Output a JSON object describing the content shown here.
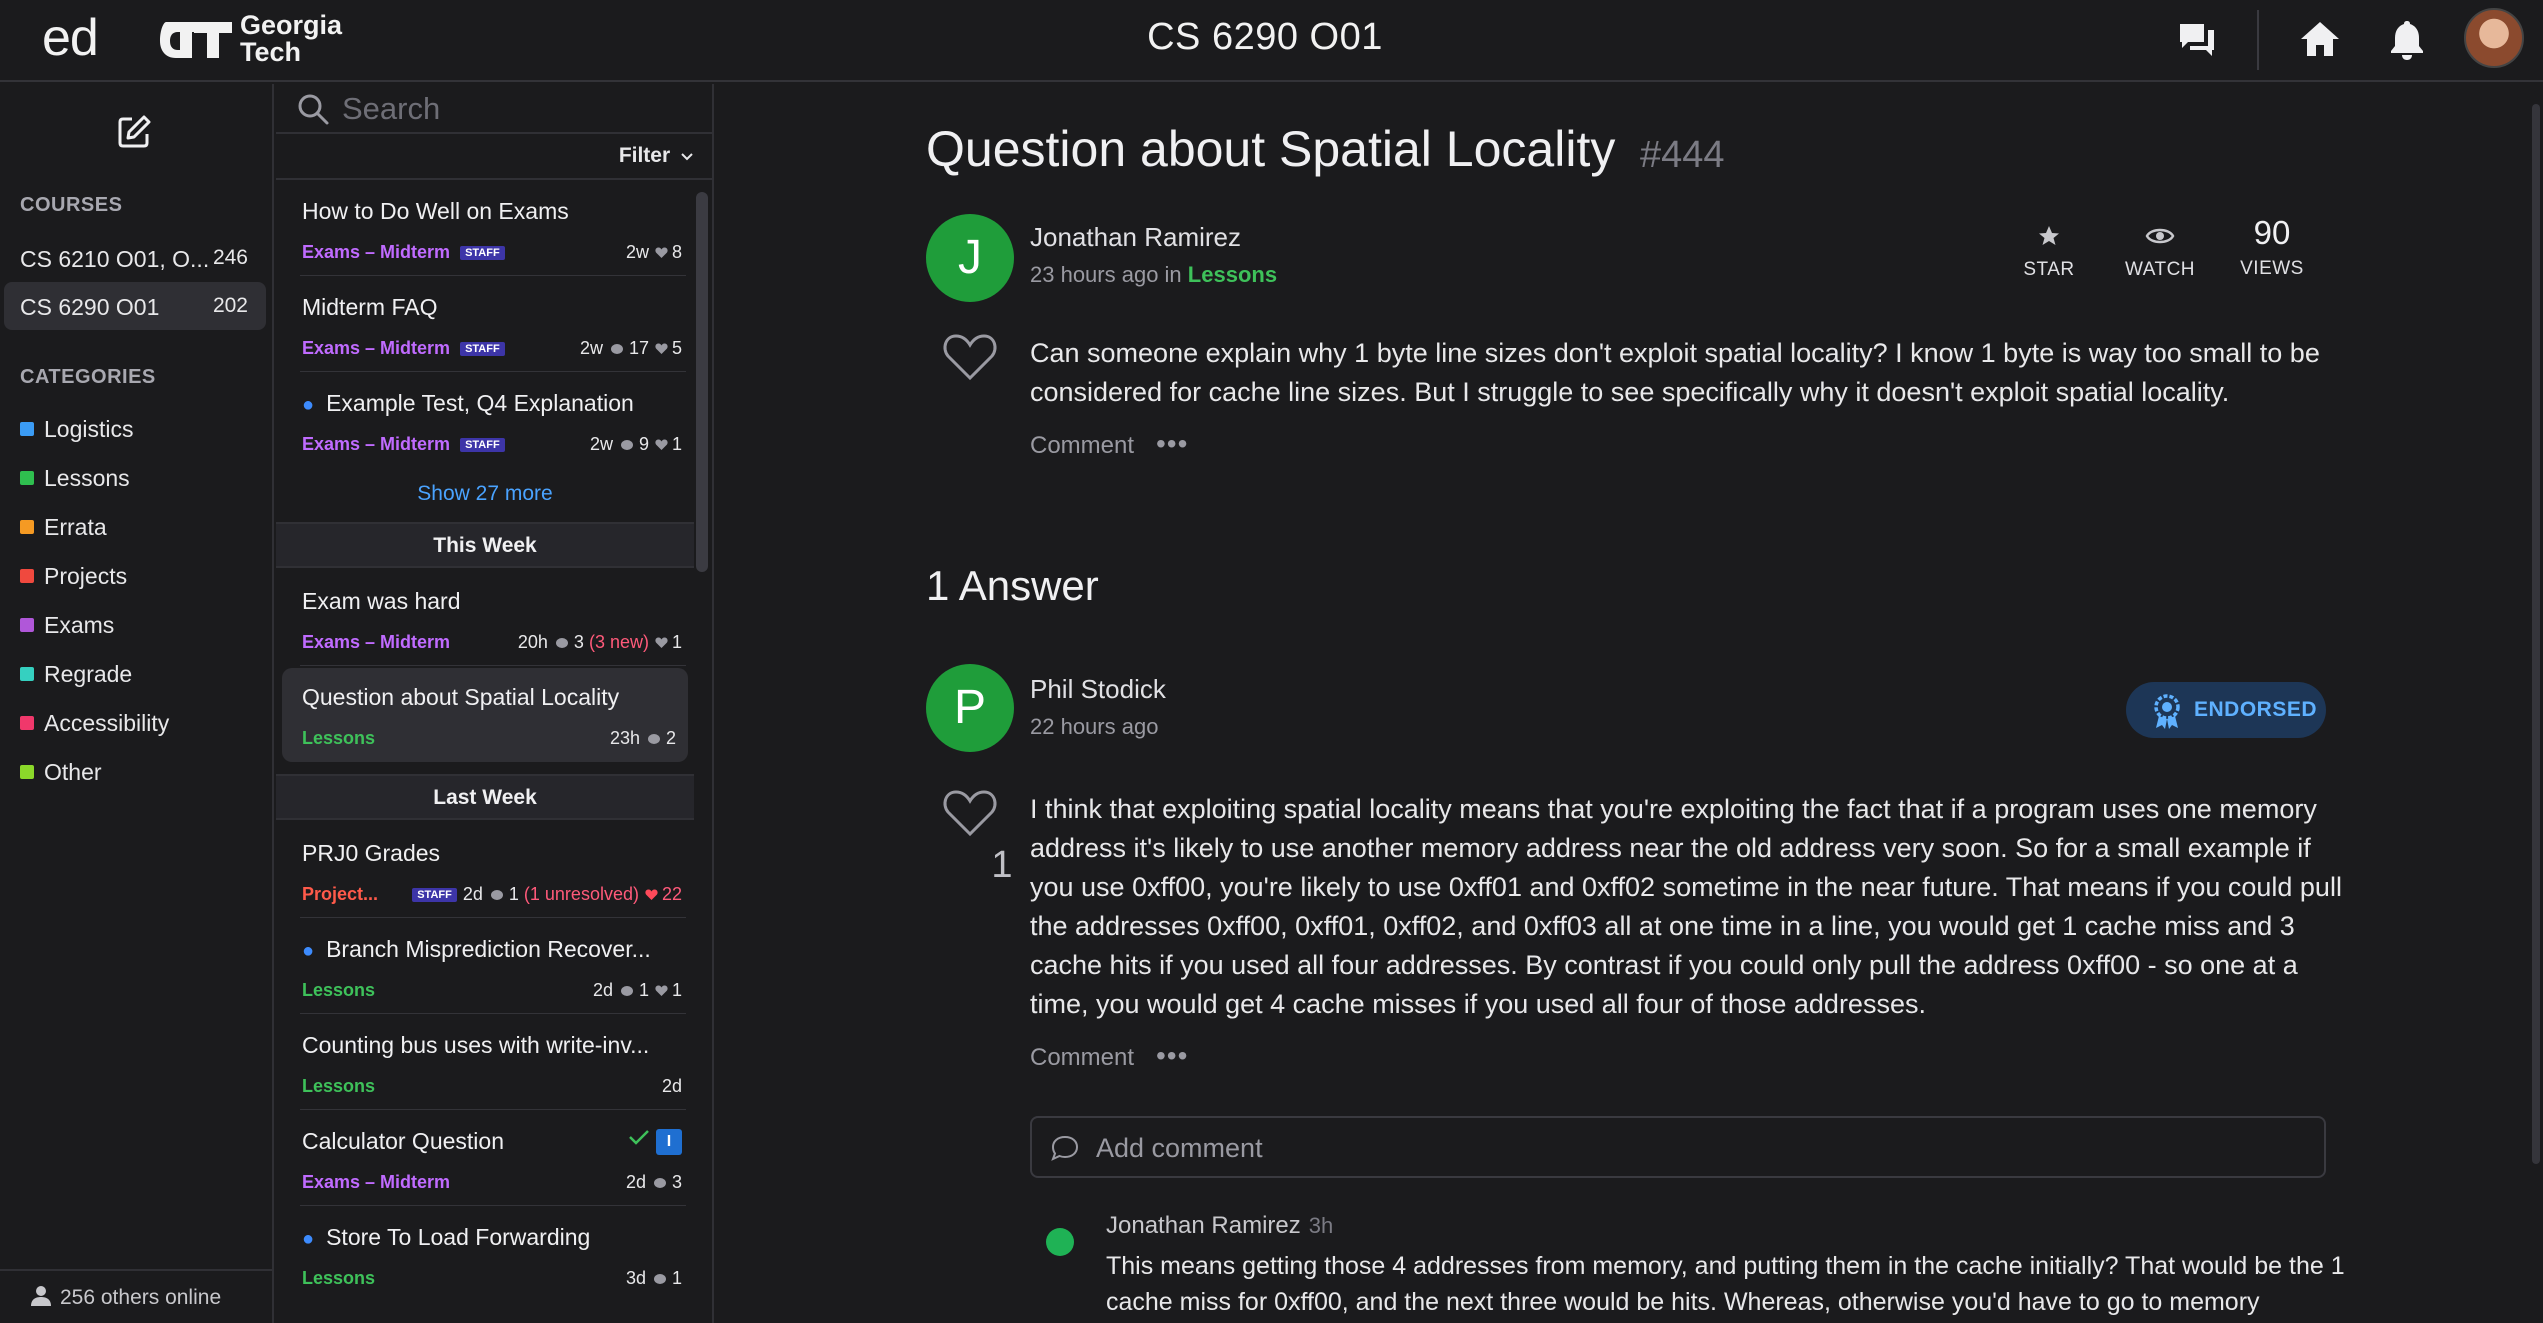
{
  "header": {
    "app_logo": "ed",
    "school_logo_line1": "Georgia",
    "school_logo_line2": "Tech",
    "course_title": "CS 6290 O01",
    "icons": [
      "chat-icon",
      "home-icon",
      "bell-icon",
      "profile-avatar"
    ]
  },
  "leftnav": {
    "courses_heading": "COURSES",
    "courses": [
      {
        "name": "CS 6210 O01, O...",
        "count": "246"
      },
      {
        "name": "CS 6290 O01",
        "count": "202"
      }
    ],
    "categories_heading": "CATEGORIES",
    "categories": [
      {
        "label": "Logistics",
        "color": "#3b9cf5"
      },
      {
        "label": "Lessons",
        "color": "#2fbf4f"
      },
      {
        "label": "Errata",
        "color": "#f59a23"
      },
      {
        "label": "Projects",
        "color": "#f0493e"
      },
      {
        "label": "Exams",
        "color": "#b057d9"
      },
      {
        "label": "Regrade",
        "color": "#35d0c0"
      },
      {
        "label": "Accessibility",
        "color": "#f0386b"
      },
      {
        "label": "Other",
        "color": "#8bd82a"
      }
    ],
    "online": "256 others online"
  },
  "threadlist": {
    "search_placeholder": "Search",
    "filter_label": "Filter",
    "pinned": [
      {
        "title": "How to Do Well on Exams",
        "cat": "Exams – Midterm",
        "staff": "STAFF",
        "time": "2w",
        "likes": "8"
      },
      {
        "title": "Midterm FAQ",
        "cat": "Exams – Midterm",
        "staff": "STAFF",
        "time": "2w",
        "replies": "17",
        "likes": "5"
      },
      {
        "title": "Example Test, Q4 Explanation",
        "cat": "Exams – Midterm",
        "staff": "STAFF",
        "time": "2w",
        "replies": "9",
        "likes": "1"
      }
    ],
    "show_more": "Show 27 more",
    "this_week_label": "This Week",
    "this_week": [
      {
        "title": "Exam was hard",
        "cat": "Exams – Midterm",
        "time": "20h",
        "replies": "3",
        "new": "(3 new)",
        "likes": "1"
      },
      {
        "title": "Question about Spatial Locality",
        "cat": "Lessons",
        "time": "23h",
        "replies": "2"
      }
    ],
    "last_week_label": "Last Week",
    "last_week": [
      {
        "title": "PRJ0 Grades",
        "cat": "Project...",
        "staff": "STAFF",
        "time": "2d",
        "replies": "1",
        "unresolved": "(1 unresolved)",
        "likes": "22"
      },
      {
        "title": "Branch Misprediction Recover...",
        "cat": "Lessons",
        "time": "2d",
        "replies": "1",
        "likes": "1"
      },
      {
        "title": "Counting bus uses with write-inv...",
        "cat": "Lessons",
        "time": "2d"
      },
      {
        "title": "Calculator Question",
        "cat": "Exams – Midterm",
        "time": "2d",
        "replies": "3",
        "badge": "I"
      },
      {
        "title": "Store To Load Forwarding",
        "cat": "Lessons",
        "time": "3d",
        "replies": "1"
      }
    ]
  },
  "question": {
    "title": "Question about Spatial Locality",
    "number": "#444",
    "avatar_letter": "J",
    "author": "Jonathan Ramirez",
    "time": "23 hours ago in",
    "category": "Lessons",
    "star_label": "STAR",
    "watch_label": "WATCH",
    "views": "90",
    "views_label": "VIEWS",
    "body": "Can someone explain why 1 byte line sizes don't exploit spatial locality? I know 1 byte is way too small to be considered for cache line sizes. But I struggle to see specifically why it doesn't exploit spatial locality.",
    "comment_label": "Comment",
    "more": "•••"
  },
  "answers": {
    "heading": "1 Answer",
    "avatar_letter": "P",
    "author": "Phil Stodick",
    "time": "22 hours ago",
    "endorsed_label": "ENDORSED",
    "votes": "1",
    "body": "I think that exploiting spatial locality means that you're exploiting the fact that if a program uses one memory address it's likely to use another memory address near the old address very soon.  So for a small example if you use 0xff00, you're likely to use 0xff01 and 0xff02 sometime in the near future.  That means if you could pull the addresses 0xff00, 0xff01, 0xff02, and 0xff03 all at one time in a line, you would get 1 cache miss and 3 cache hits if you used all four addresses.  By contrast if you could only pull the address 0xff00 - so one at a time, you would get 4 cache misses if you used all four of those addresses.",
    "comment_label": "Comment",
    "more": "•••",
    "add_comment_placeholder": "Add comment",
    "reply": {
      "author": "Jonathan Ramirez",
      "time": "3h",
      "body": "This means getting those 4 addresses from memory, and putting them in the cache initially? That would be the 1 cache miss for 0xff00, and the next three would be hits. Whereas, otherwise you'd have to go to memory"
    }
  },
  "colors": {
    "exam_cat": "#c06bff",
    "lesson_cat": "#3ec15a",
    "project_cat": "#ff5a4a",
    "link": "#4aa3ff"
  }
}
